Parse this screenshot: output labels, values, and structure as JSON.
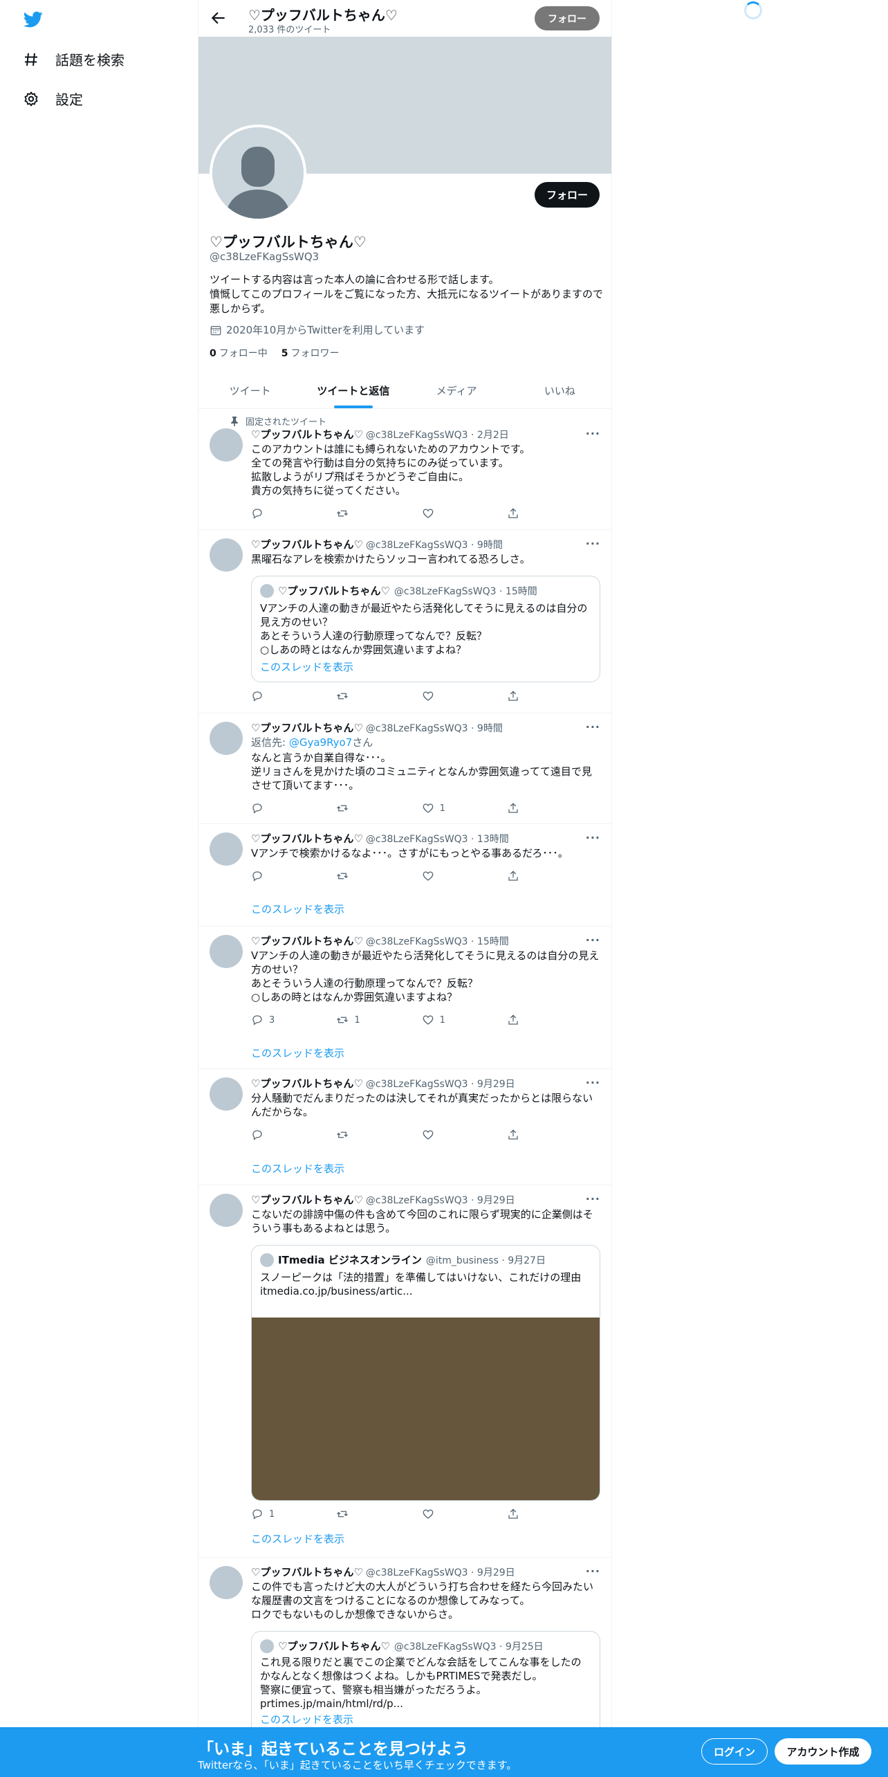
{
  "nav": {
    "explore_label": "話題を検索",
    "settings_label": "設定"
  },
  "header": {
    "title": "♡プッフバルトちゃん♡",
    "tweet_count": "2,033 件のツイート",
    "follow_label": "フォロー"
  },
  "profile": {
    "name": "♡プッフバルトちゃん♡",
    "handle": "@c38LzeFKagSsWQ3",
    "bio": "ツイートする内容は言った本人の論に合わせる形で話します。\n憤慨してこのプロフィールをご覧になった方、大抵元になるツイートがありますので悪しからず。",
    "joined": "2020年10月からTwitterを利用しています",
    "following_count": "0",
    "following_label": "フォロー中",
    "followers_count": "5",
    "followers_label": "フォロワー",
    "follow_label": "フォロー"
  },
  "tabs": [
    "ツイート",
    "ツイートと返信",
    "メディア",
    "いいね"
  ],
  "pinned_label": "固定されたツイート",
  "show_thread_label": "このスレッドを表示",
  "tweets": [
    {
      "name": "♡プッフバルトちゃん♡",
      "meta": "@c38LzeFKagSsWQ3 · 2月2日",
      "text": "このアカウントは誰にも縛られないためのアカウントです。\n全ての発言や行動は自分の気持ちにのみ従っています。\n拡散しようがリプ飛ばそうかどうぞご自由に。\n貴方の気持ちに従ってください。",
      "reply": "",
      "retweet": "",
      "like": ""
    },
    {
      "name": "♡プッフバルトちゃん♡",
      "meta": "@c38LzeFKagSsWQ3 · 9時間",
      "text": "黒曜石なアレを検索かけたらソッコー言われてる恐ろしさ。",
      "quote": {
        "name": "♡プッフバルトちゃん♡",
        "meta": "@c38LzeFKagSsWQ3 · 15時間",
        "text": "Vアンチの人達の動きが最近やたら活発化してそうに見えるのは自分の見え方のせい？\nあとそういう人達の行動原理ってなんで？反転？\n○しあの時とはなんか雰囲気違いますよね？"
      },
      "reply": "",
      "retweet": "",
      "like": ""
    },
    {
      "name": "♡プッフバルトちゃん♡",
      "meta": "@c38LzeFKagSsWQ3 · 9時間",
      "reply_to_prefix": "返信先: ",
      "reply_to_handle": "@Gya9Ryo7",
      "reply_to_suffix": "さん",
      "text": "なんと言うか自業自得な･･･。\n逆リョさんを見かけた頃のコミュニティとなんか雰囲気違ってて遠目で見させて頂いてます･･･。",
      "reply": "",
      "retweet": "",
      "like": "1"
    },
    {
      "name": "♡プッフバルトちゃん♡",
      "meta": "@c38LzeFKagSsWQ3 · 13時間",
      "text": "Vアンチで検索かけるなよ･･･。さすがにもっとやる事あるだろ･･･。",
      "reply": "",
      "retweet": "",
      "like": ""
    },
    {
      "name": "♡プッフバルトちゃん♡",
      "meta": "@c38LzeFKagSsWQ3 · 15時間",
      "text": "Vアンチの人達の動きが最近やたら活発化してそうに見えるのは自分の見え方のせい？\nあとそういう人達の行動原理ってなんで？反転？\n○しあの時とはなんか雰囲気違いますよね？",
      "reply": "3",
      "retweet": "1",
      "like": "1"
    },
    {
      "name": "♡プッフバルトちゃん♡",
      "meta": "@c38LzeFKagSsWQ3 · 9月29日",
      "text": "分人騒動でだんまりだったのは決してそれが真実だったからとは限らないんだからな。",
      "reply": "",
      "retweet": "",
      "like": ""
    },
    {
      "name": "♡プッフバルトちゃん♡",
      "meta": "@c38LzeFKagSsWQ3 · 9月29日",
      "text": "こないだの誹謗中傷の件も含めて今回のこれに限らず現実的に企業側はそういう事もあるよねとは思う。",
      "quote": {
        "name": "ITmedia ビジネスオンライン",
        "meta": "@itm_business · 9月27日",
        "text": "スノーピークは「法的措置」を準備してはいけない、これだけの理由\nitmedia.co.jp/business/artic..."
      },
      "reply": "1",
      "retweet": "",
      "like": ""
    },
    {
      "name": "♡プッフバルトちゃん♡",
      "meta": "@c38LzeFKagSsWQ3 · 9月29日",
      "text": "この件でも言ったけど大の大人がどういう打ち合わせを経たら今回みたいな履歴書の文言をつけることになるのか想像してみなって。\nロクでもないものしか想像できないからさ。",
      "quote": {
        "name": "♡プッフバルトちゃん♡",
        "meta": "@c38LzeFKagSsWQ3 · 9月25日",
        "text": "これ見る限りだと裏でこの企業でどんな会話をしてこんな事をしたのかなんとなく想像はつくよね。しかもPRTIMESで発表だし。\n警察に便宜って、警察も相当嫌がっただろうよ。\nprtimes.jp/main/html/rd/p..."
      },
      "reply": "",
      "retweet": "",
      "like": ""
    }
  ],
  "bottom_bar": {
    "title": "「いま」起きていることを見つけよう",
    "subtitle": "Twitterなら、「いま」起きていることをいち早くチェックできます。",
    "login_label": "ログイン",
    "signup_label": "アカウント作成"
  },
  "colors": {
    "accent": "#1d9bf0",
    "banner": "#cfd9de",
    "text": "#0f1419",
    "secondary": "#536471"
  }
}
